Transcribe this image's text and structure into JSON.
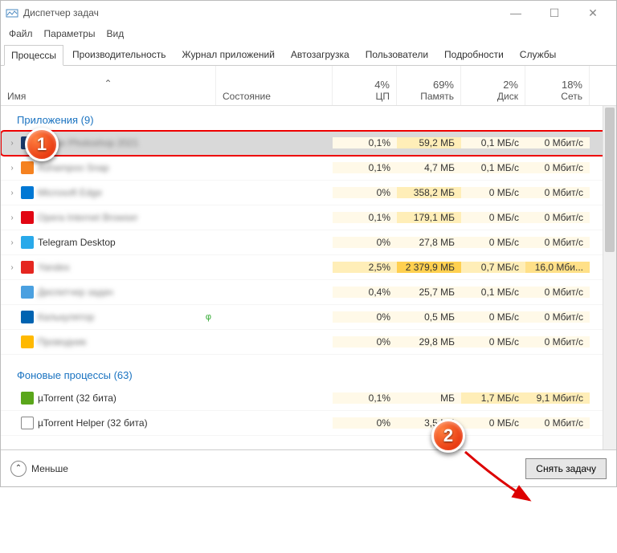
{
  "window": {
    "title": "Диспетчер задач"
  },
  "menu": [
    "Файл",
    "Параметры",
    "Вид"
  ],
  "tabs": [
    "Процессы",
    "Производительность",
    "Журнал приложений",
    "Автозагрузка",
    "Пользователи",
    "Подробности",
    "Службы"
  ],
  "active_tab": 0,
  "headers": {
    "name": "Имя",
    "state": "Состояние",
    "cpu": {
      "pct": "4%",
      "label": "ЦП"
    },
    "mem": {
      "pct": "69%",
      "label": "Память"
    },
    "disk": {
      "pct": "2%",
      "label": "Диск"
    },
    "net": {
      "pct": "18%",
      "label": "Сеть"
    }
  },
  "groups": {
    "apps": "Приложения (9)",
    "bg": "Фоновые процессы (63)"
  },
  "rows": [
    {
      "expand": true,
      "icon": "#1a3b6e",
      "name": "Adobe Photoshop 2021",
      "blur": true,
      "cpu": "0,1%",
      "mem": "59,2 МБ",
      "disk": "0,1 МБ/с",
      "net": "0 Мбит/с",
      "bg_cpu": "bg1",
      "bg_mem": "bg2",
      "bg_disk": "bg1",
      "bg_net": "bg1",
      "selected": true,
      "highlight": true
    },
    {
      "expand": true,
      "icon": "#f58220",
      "name": "Ashampoo Snap",
      "blur": true,
      "cpu": "0,1%",
      "mem": "4,7 МБ",
      "disk": "0,1 МБ/с",
      "net": "0 Мбит/с",
      "bg_cpu": "bg1",
      "bg_mem": "bg1",
      "bg_disk": "bg1",
      "bg_net": "bg1"
    },
    {
      "expand": true,
      "icon": "#0078d4",
      "name": "Microsoft Edge",
      "blur": true,
      "cpu": "0%",
      "mem": "358,2 МБ",
      "disk": "0 МБ/с",
      "net": "0 Мбит/с",
      "bg_cpu": "bg1",
      "bg_mem": "bg2",
      "bg_disk": "bg1",
      "bg_net": "bg1"
    },
    {
      "expand": true,
      "icon": "#e20613",
      "name": "Opera Internet Browser",
      "blur": true,
      "cpu": "0,1%",
      "mem": "179,1 МБ",
      "disk": "0 МБ/с",
      "net": "0 Мбит/с",
      "bg_cpu": "bg1",
      "bg_mem": "bg2",
      "bg_disk": "bg1",
      "bg_net": "bg1"
    },
    {
      "expand": true,
      "icon": "#29a9ea",
      "name": "Telegram Desktop",
      "blur": false,
      "cpu": "0%",
      "mem": "27,8 МБ",
      "disk": "0 МБ/с",
      "net": "0 Мбит/с",
      "bg_cpu": "bg1",
      "bg_mem": "bg1",
      "bg_disk": "bg1",
      "bg_net": "bg1"
    },
    {
      "expand": true,
      "icon": "#e52620",
      "name": "Yandex",
      "blur": true,
      "cpu": "2,5%",
      "mem": "2 379,9 МБ",
      "disk": "0,7 МБ/с",
      "net": "16,0 Мби...",
      "bg_cpu": "bg2",
      "bg_mem": "bg4",
      "bg_disk": "bg2",
      "bg_net": "bg3"
    },
    {
      "expand": false,
      "icon": "#4aa0e0",
      "name": "Диспетчер задач",
      "blur": true,
      "cpu": "0,4%",
      "mem": "25,7 МБ",
      "disk": "0,1 МБ/с",
      "net": "0 Мбит/с",
      "bg_cpu": "bg1",
      "bg_mem": "bg1",
      "bg_disk": "bg1",
      "bg_net": "bg1"
    },
    {
      "expand": false,
      "icon": "#0063b1",
      "name": "Калькулятор",
      "blur": true,
      "cpu": "0%",
      "mem": "0,5 МБ",
      "disk": "0 МБ/с",
      "net": "0 Мбит/с",
      "bg_cpu": "bg1",
      "bg_mem": "bg1",
      "bg_disk": "bg1",
      "bg_net": "bg1",
      "leaf": true
    },
    {
      "expand": false,
      "icon": "#ffb900",
      "name": "Проводник",
      "blur": true,
      "cpu": "0%",
      "mem": "29,8 МБ",
      "disk": "0 МБ/с",
      "net": "0 Мбит/с",
      "bg_cpu": "bg1",
      "bg_mem": "bg1",
      "bg_disk": "bg1",
      "bg_net": "bg1"
    }
  ],
  "bg_rows": [
    {
      "icon": "#5aa61b",
      "name": "µTorrent (32 бита)",
      "cpu": "0,1%",
      "mem": "МБ",
      "disk": "1,7 МБ/с",
      "net": "9,1 Мбит/с",
      "bg_cpu": "bg1",
      "bg_mem": "bg1",
      "bg_disk": "bg2",
      "bg_net": "bg2"
    },
    {
      "icon": "#ffffff",
      "name": "µTorrent Helper (32 бита)",
      "cpu": "0%",
      "mem": "3,5 МБ",
      "disk": "0 МБ/с",
      "net": "0 Мбит/с",
      "bg_cpu": "bg1",
      "bg_mem": "bg1",
      "bg_disk": "bg1",
      "bg_net": "bg1",
      "border": true
    }
  ],
  "footer": {
    "less": "Меньше",
    "end_task": "Снять задачу"
  },
  "markers": {
    "m1": "1",
    "m2": "2"
  }
}
